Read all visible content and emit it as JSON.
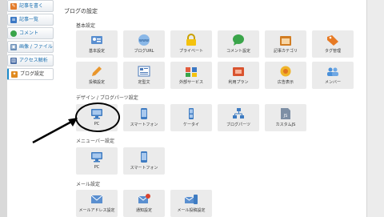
{
  "sidebar": {
    "items": [
      {
        "label": "記事を書く",
        "icon": "pencil-icon"
      },
      {
        "label": "記事一覧",
        "icon": "list-icon"
      },
      {
        "label": "コメント",
        "icon": "comment-icon"
      },
      {
        "label": "画像 / ファイル",
        "icon": "image-icon"
      },
      {
        "label": "アクセス解析",
        "icon": "chart-icon"
      },
      {
        "label": "ブログ設定",
        "icon": "wrench-icon"
      }
    ]
  },
  "page": {
    "title": "ブログの設定"
  },
  "sections": {
    "basic": {
      "title": "基本設定",
      "tiles": [
        {
          "label": "基本設定",
          "icon": "id-card-icon"
        },
        {
          "label": "ブログURL",
          "icon": "globe-www-icon",
          "badge": "www"
        },
        {
          "label": "プライベート",
          "icon": "lock-icon"
        },
        {
          "label": "コメント設定",
          "icon": "speech-bubble-icon"
        },
        {
          "label": "記事カテゴリ",
          "icon": "folder-icon"
        },
        {
          "label": "タグ管理",
          "icon": "tag-icon"
        },
        {
          "label": "投稿設定",
          "icon": "pencil-icon"
        },
        {
          "label": "定型文",
          "icon": "template-icon"
        },
        {
          "label": "外部サービス",
          "icon": "service-icon"
        },
        {
          "label": "利用プラン",
          "icon": "plan-icon"
        },
        {
          "label": "広告表示",
          "icon": "ad-icon"
        },
        {
          "label": "メンバー",
          "icon": "members-icon"
        }
      ]
    },
    "design": {
      "title": "デザイン / ブログパーツ設定",
      "tiles": [
        {
          "label": "PC",
          "icon": "monitor-icon"
        },
        {
          "label": "スマートフォン",
          "icon": "smartphone-icon"
        },
        {
          "label": "ケータイ",
          "icon": "mobile-phone-icon"
        },
        {
          "label": "ブログパーツ",
          "icon": "parts-icon"
        },
        {
          "label": "カスタムJS",
          "icon": "js-file-icon",
          "badge": "JS"
        }
      ]
    },
    "menubar": {
      "title": "メニューバー設定",
      "tiles": [
        {
          "label": "PC",
          "icon": "monitor-icon"
        },
        {
          "label": "スマートフォン",
          "icon": "smartphone-icon"
        }
      ]
    },
    "mail": {
      "title": "メール設定",
      "tiles": [
        {
          "label": "メールアドレス設定",
          "icon": "mail-icon"
        },
        {
          "label": "通知設定",
          "icon": "notification-icon"
        },
        {
          "label": "メール投稿設定",
          "icon": "mail-post-icon"
        }
      ]
    }
  },
  "colors": {
    "accent": "#1a89c9",
    "tile_bg": "#ebebeb",
    "annotation": "#000000"
  }
}
